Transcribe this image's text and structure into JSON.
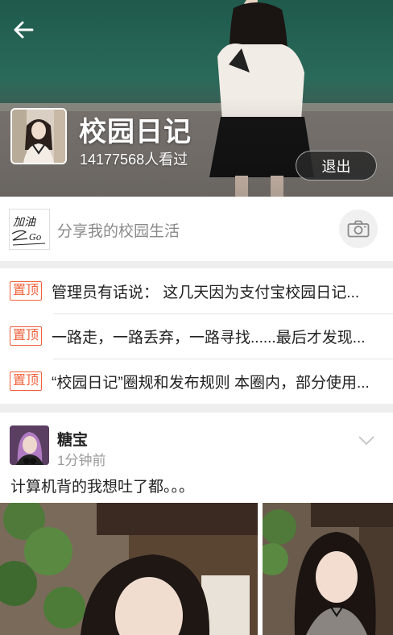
{
  "header": {
    "group_title": "校园日记",
    "views": "14177568人看过",
    "exit_label": "退出"
  },
  "share": {
    "placeholder": "分享我的校园生活",
    "logo_text_top": "加油",
    "logo_text_bottom": "Go"
  },
  "pinned": {
    "badge": "置顶",
    "items": [
      {
        "text": "管理员有话说：  这几天因为支付宝校园日记..."
      },
      {
        "text": "一路走，一路丢弃，一路寻找......最后才发现..."
      },
      {
        "text": "“校园日记”圈规和发布规则  本圈内，部分使用..."
      }
    ]
  },
  "post": {
    "author": "糖宝",
    "time": "1分钟前",
    "content": "计算机背的我想吐了都。。。"
  },
  "icons": {
    "back": "arrow-left-icon",
    "camera": "camera-icon",
    "more": "chevron-down-icon"
  },
  "colors": {
    "pin_accent": "#f0603a",
    "header_green": "#1f5a4c",
    "muted_text": "#9a9a9a"
  }
}
